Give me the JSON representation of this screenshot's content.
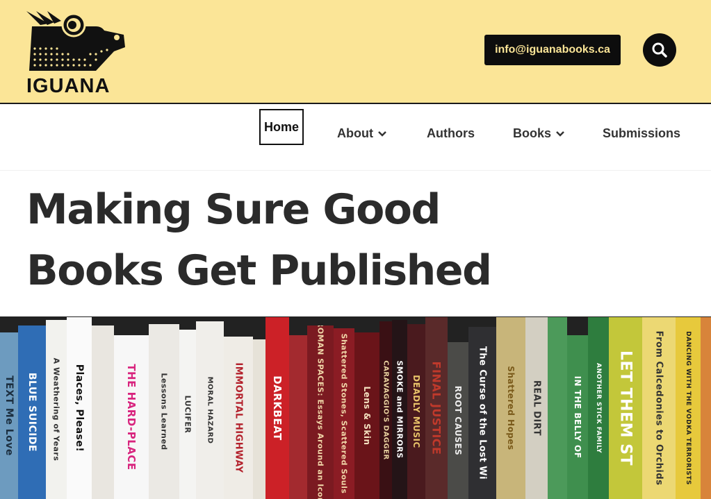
{
  "header": {
    "logo_text": "IGUANA",
    "email_label": "info@iguanabooks.ca",
    "search_icon": "search-icon"
  },
  "nav": {
    "items": [
      {
        "label": "Home",
        "active": true
      },
      {
        "label": "About",
        "has_dropdown": true
      },
      {
        "label": "Authors"
      },
      {
        "label": "Books",
        "has_dropdown": true
      },
      {
        "label": "Submissions"
      }
    ]
  },
  "hero": {
    "line1": "Making Sure Good",
    "line2": "Books Get Published"
  },
  "banner": {
    "spines": [
      "TEXT Me Love",
      "BLUE SUICIDE",
      "A Weathering of Years",
      "Places, Please!",
      "THE HARD-PLACE",
      "Lessons Learned",
      "LUCIFER",
      "MORAL HAZARD",
      "IMMORTAL HIGHWAY",
      "DARKBEAT",
      "ROMAN SPACES: Essays Around an Icon",
      "Shattered Stones, Scattered Souls",
      "Lens & Skin",
      "CARAVAGGIO'S DAGGER",
      "SMOKE and MIRRORS",
      "DEADLY MUSIC",
      "FINAL JUSTICE",
      "ROOT CAUSES",
      "The Curse of the Lost Wi",
      "Shattered Hopes",
      "REAL DIRT",
      "IN THE BELLY OF",
      "ANOTHER STICK FAMILY",
      "LET THEM ST",
      "From Calcedonies to Orchids",
      "DANCING WITH THE VODKA TERRORISTS"
    ]
  },
  "colors": {
    "header_bg": "#fbe597",
    "text_dark": "#2b2b2b",
    "button_bg": "#0d0d0d",
    "button_text": "#fbe597"
  }
}
